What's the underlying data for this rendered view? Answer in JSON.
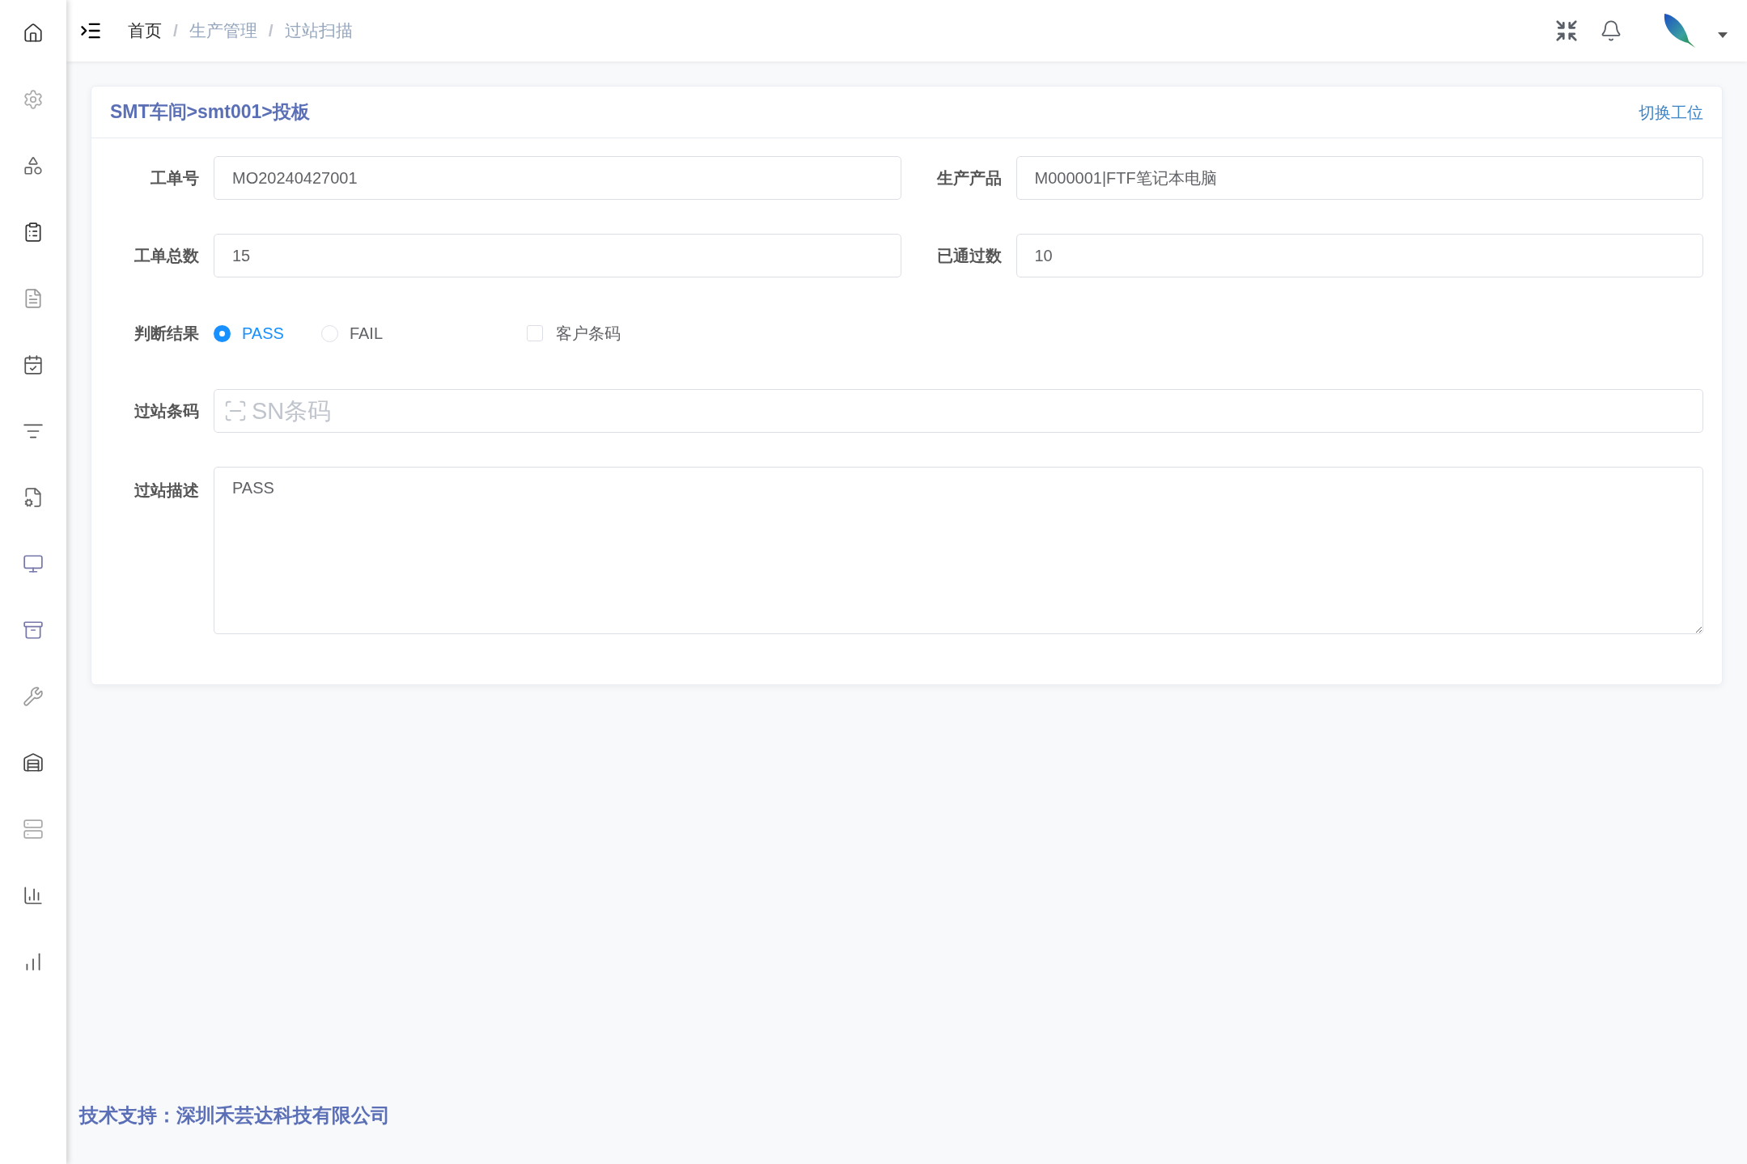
{
  "header": {
    "breadcrumb": [
      {
        "label": "首页",
        "kind": "link"
      },
      {
        "label": "生产管理",
        "kind": "plain"
      },
      {
        "label": "过站扫描",
        "kind": "plain"
      }
    ],
    "separator": "/"
  },
  "card": {
    "title": "SMT车间>smt001>投板",
    "action": "切换工位",
    "rows": [
      [
        {
          "label": "工单号",
          "value": "MO20240427001"
        },
        {
          "label": "生产产品",
          "value": "M000001|FTF笔记本电脑"
        }
      ],
      [
        {
          "label": "工单总数",
          "value": "15"
        },
        {
          "label": "已通过数",
          "value": "10"
        }
      ]
    ],
    "result": {
      "label": "判断结果",
      "options": [
        {
          "label": "PASS",
          "selected": true
        },
        {
          "label": "FAIL",
          "selected": false
        }
      ],
      "customer_barcode": {
        "label": "客户条码",
        "checked": false
      }
    },
    "barcode": {
      "label": "过站条码",
      "placeholder": "SN条码"
    },
    "description": {
      "label": "过站描述",
      "value": "PASS"
    }
  },
  "footer": "技术支持：深圳禾芸达科技有限公司"
}
